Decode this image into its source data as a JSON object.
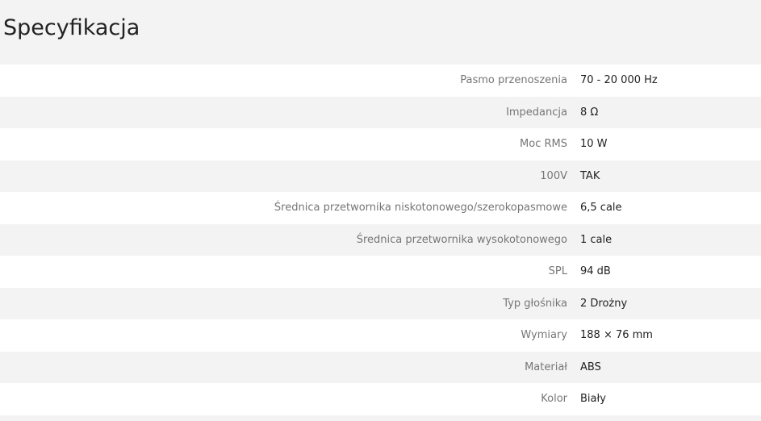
{
  "section": {
    "title": "Specyfikacja"
  },
  "specs": [
    {
      "label": "Pasmo przenoszenia",
      "value": "70 - 20 000 Hz"
    },
    {
      "label": "Impedancja",
      "value": "8 Ω"
    },
    {
      "label": "Moc RMS",
      "value": "10 W"
    },
    {
      "label": "100V",
      "value": "TAK"
    },
    {
      "label": "Średnica przetwornika niskotonowego/szerokopasmowe",
      "value": "6,5 cale"
    },
    {
      "label": "Średnica przetwornika wysokotonowego",
      "value": "1 cale"
    },
    {
      "label": "SPL",
      "value": "94 dB"
    },
    {
      "label": "Typ głośnika",
      "value": "2 Drożny"
    },
    {
      "label": "Wymiary",
      "value": "188 × 76 mm"
    },
    {
      "label": "Materiał",
      "value": "ABS"
    },
    {
      "label": "Kolor",
      "value": "Biały"
    }
  ]
}
